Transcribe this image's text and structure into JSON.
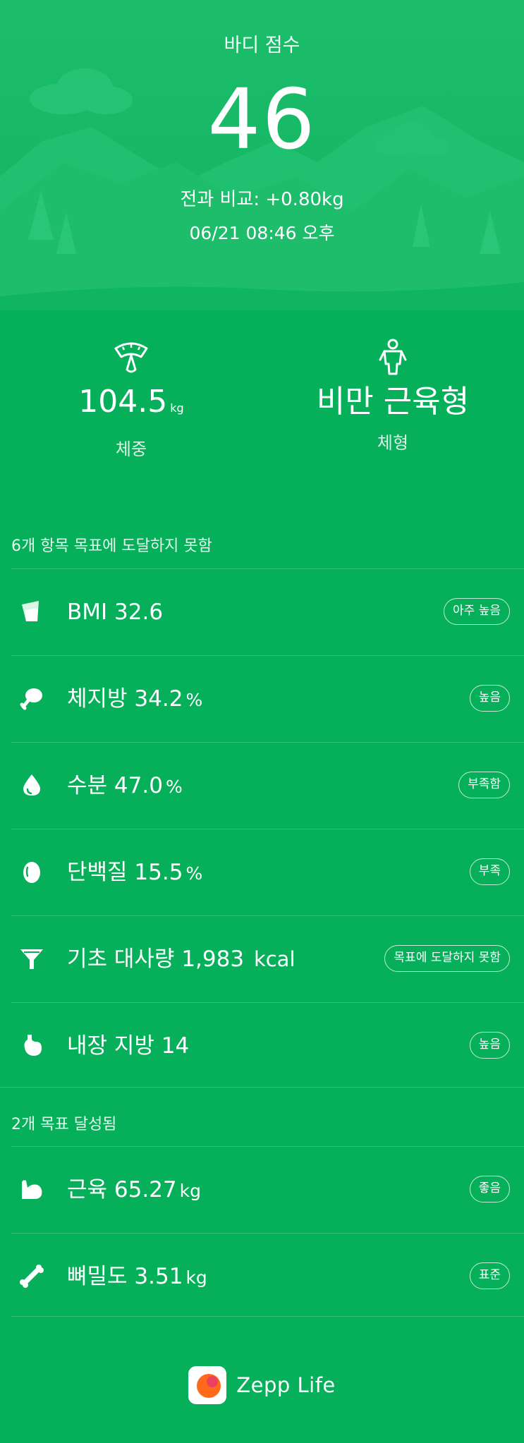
{
  "header": {
    "title": "바디 점수",
    "score": "46",
    "compare": "전과 비교: +0.80kg",
    "datetime": "06/21 08:46 오후"
  },
  "stats": {
    "weight": {
      "value": "104.5",
      "unit": "kg",
      "label": "체중",
      "icon": "scale-icon"
    },
    "body_type": {
      "value": "비만 근육형",
      "label": "체형",
      "icon": "body-figure-icon"
    }
  },
  "unmet": {
    "title": "6개 항목 목표에 도달하지 못함",
    "items": [
      {
        "name": "BMI",
        "value": "32.6",
        "unit": "",
        "badge": "아주 높음",
        "icon": "cup-icon"
      },
      {
        "name": "체지방",
        "value": "34.2",
        "unit": "%",
        "badge": "높음",
        "icon": "drumstick-icon"
      },
      {
        "name": "수분",
        "value": "47.0",
        "unit": "%",
        "badge": "부족함",
        "icon": "water-drop-icon"
      },
      {
        "name": "단백질",
        "value": "15.5",
        "unit": "%",
        "badge": "부족",
        "icon": "egg-icon"
      },
      {
        "name": "기초 대사량",
        "value": "1,983",
        "unit": "kcal",
        "badge": "목표에 도달하지 못함",
        "icon": "funnel-icon"
      },
      {
        "name": "내장 지방",
        "value": "14",
        "unit": "",
        "badge": "높음",
        "icon": "stomach-icon"
      }
    ]
  },
  "met": {
    "title": "2개 목표 달성됨",
    "items": [
      {
        "name": "근육",
        "value": "65.27",
        "unit": "kg",
        "badge": "좋음",
        "icon": "bicep-icon"
      },
      {
        "name": "뼈밀도",
        "value": "3.51",
        "unit": "kg",
        "badge": "표준",
        "icon": "bone-icon"
      }
    ]
  },
  "footer": {
    "brand": "Zepp Life",
    "icon": "zepp-life-logo-icon"
  },
  "colors": {
    "background": "#06b05a",
    "hero": "#16b866",
    "text": "#ffffff",
    "logo_orange": "#ff6a1a"
  }
}
